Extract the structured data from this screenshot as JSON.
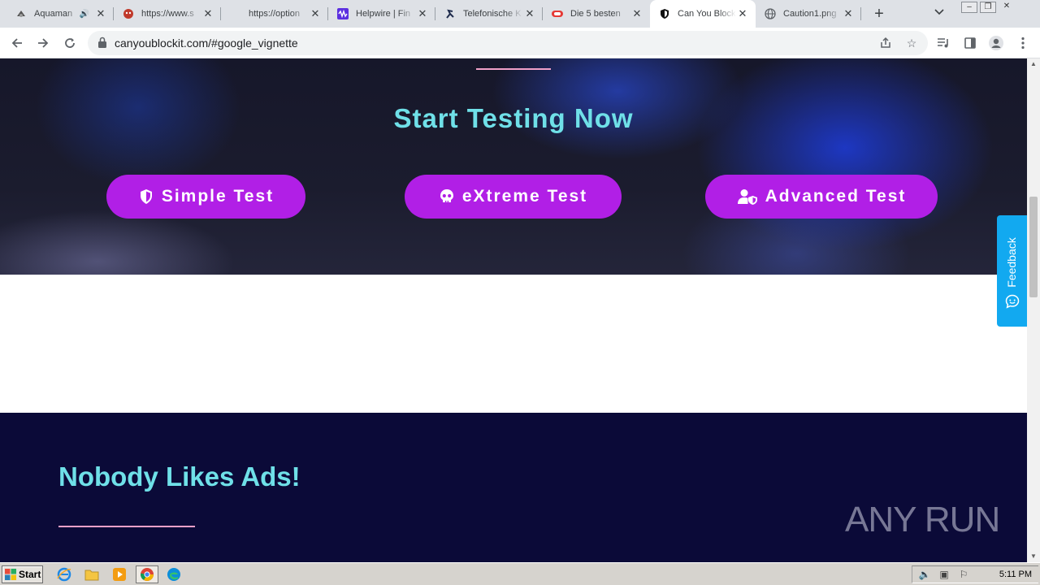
{
  "browser": {
    "tabs": [
      {
        "title": "Aquaman",
        "icon": "aquaman-favicon",
        "audio": true
      },
      {
        "title": "https://www.s",
        "icon": "red-bug-favicon"
      },
      {
        "title": "https://option",
        "icon": "blank-favicon"
      },
      {
        "title": "Helpwire | Fin",
        "icon": "helpwire-favicon"
      },
      {
        "title": "Telefonische K",
        "icon": "runner-favicon"
      },
      {
        "title": "Die 5 besten",
        "icon": "red-pill-favicon"
      },
      {
        "title": "Can You Block",
        "icon": "shield-favicon",
        "active": true
      },
      {
        "title": "Caution1.png",
        "icon": "globe-favicon"
      }
    ],
    "new_tab_label": "+",
    "url": "canyoublockit.com/#google_vignette"
  },
  "page": {
    "hero_title": "Start Testing Now",
    "buttons": [
      {
        "label": "Simple Test",
        "icon": "shield-icon"
      },
      {
        "label": "eXtreme Test",
        "icon": "skull-icon"
      },
      {
        "label": "Advanced Test",
        "icon": "user-shield-icon"
      }
    ],
    "section_title": "Nobody Likes Ads!",
    "feedback_label": "Feedback",
    "watermark": "ANY RUN"
  },
  "colors": {
    "accent_cyan": "#6fe0e8",
    "button_purple": "#b11fe6",
    "navy": "#0b0a38",
    "feedback_blue": "#12a9f0",
    "underline_pink": "#f0a0c8"
  },
  "taskbar": {
    "start_label": "Start",
    "clock": "5:11 PM"
  }
}
